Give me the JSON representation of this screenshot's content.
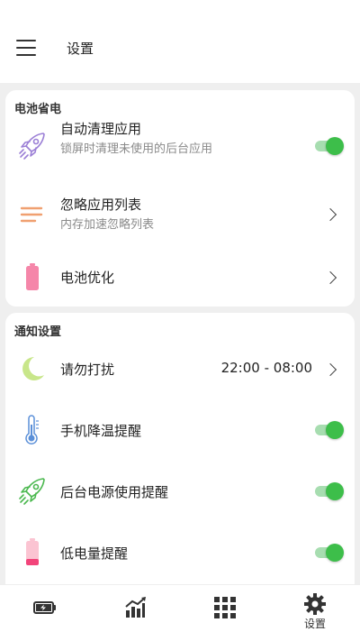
{
  "header": {
    "title": "设置"
  },
  "sections": {
    "battery": {
      "title": "电池省电",
      "auto_clean": {
        "title": "自动清理应用",
        "subtitle": "锁屏时清理未使用的后台应用",
        "enabled": true
      },
      "ignore_list": {
        "title": "忽略应用列表",
        "subtitle": "内存加速忽略列表"
      },
      "battery_opt": {
        "title": "电池优化"
      }
    },
    "notification": {
      "title": "通知设置",
      "dnd": {
        "title": "请勿打扰",
        "value": "22:00 - 08:00"
      },
      "cooling": {
        "title": "手机降温提醒",
        "enabled": true
      },
      "bg_power": {
        "title": "后台电源使用提醒",
        "enabled": true
      },
      "low_battery": {
        "title": "低电量提醒",
        "enabled": true
      }
    }
  },
  "bottom_nav": {
    "items": [
      {
        "icon": "battery-charge-icon",
        "label": ""
      },
      {
        "icon": "chart-icon",
        "label": ""
      },
      {
        "icon": "grid-icon",
        "label": ""
      },
      {
        "icon": "gear-icon",
        "label": "设置"
      }
    ]
  },
  "colors": {
    "toggle_on": "#3dbe4a",
    "rocket_purple": "#9b7fd6",
    "list_orange": "#f0a070",
    "battery_pink": "#f586a9",
    "moon_green": "#c8e68a",
    "rocket_green": "#4ab84e"
  }
}
